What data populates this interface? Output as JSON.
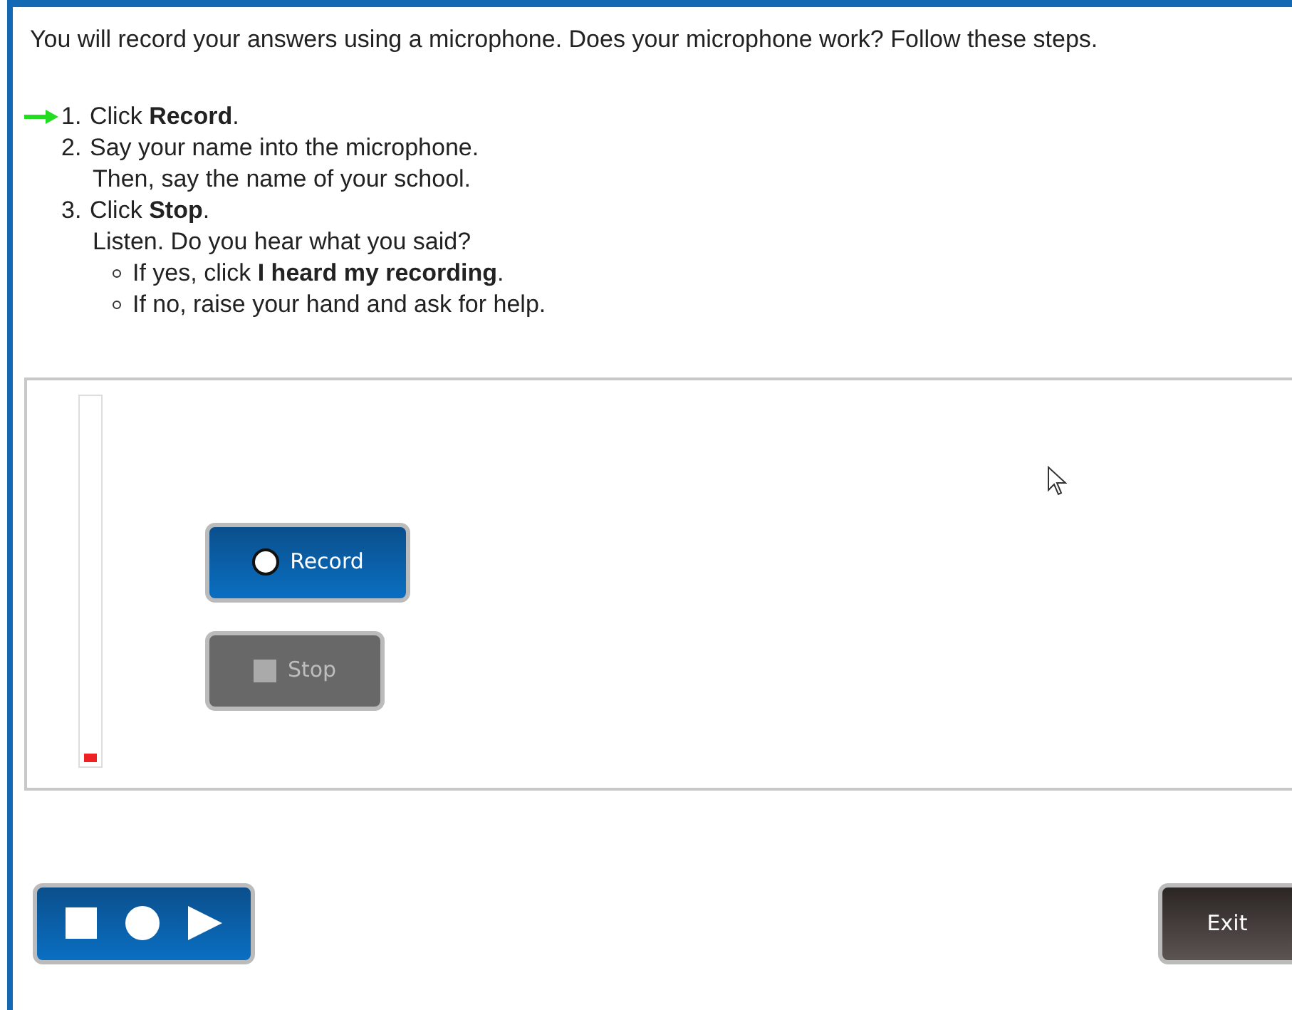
{
  "intro": "You will record your answers using a microphone. Does your microphone work? Follow these steps.",
  "steps": [
    {
      "number": "1.",
      "text": "Click **Record**.",
      "current": true
    },
    {
      "number": "2.",
      "text": "Say your name into the microphone.",
      "current": false,
      "lines": [
        "Then, say the name of your school."
      ]
    },
    {
      "number": "3.",
      "text": "Click **Stop**.",
      "current": false,
      "lines": [
        "Listen. Do you hear what you said?"
      ],
      "bullets": [
        "If yes, click **I heard my recording**.",
        "If no, raise your hand and ask for help."
      ]
    }
  ],
  "recorder": {
    "meter": {
      "level": 0.02
    },
    "record_button": {
      "label": "Record",
      "disabled": false
    },
    "stop_button": {
      "label": "Stop",
      "disabled": true
    }
  },
  "exit_button": {
    "label": "Exit"
  }
}
